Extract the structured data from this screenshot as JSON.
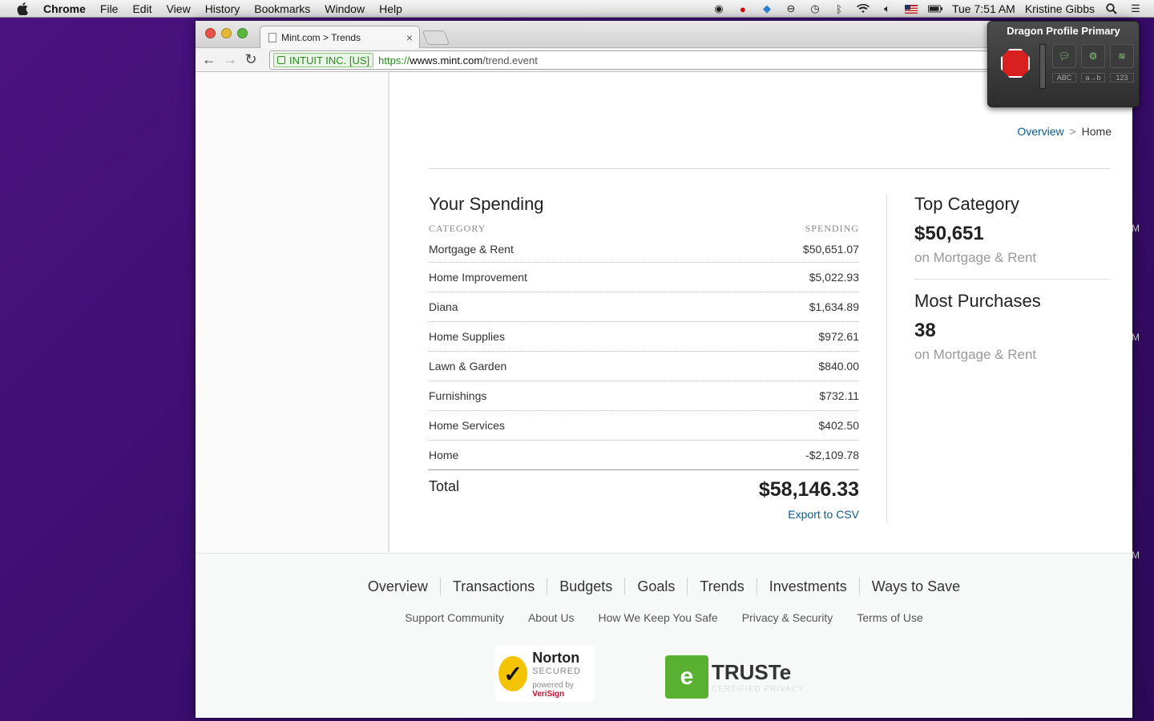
{
  "menubar": {
    "app": "Chrome",
    "items": [
      "File",
      "Edit",
      "View",
      "History",
      "Bookmarks",
      "Window",
      "Help"
    ],
    "clock": "Tue 7:51 AM",
    "user": "Kristine Gibbs"
  },
  "browser": {
    "tab_title": "Mint.com > Trends",
    "ev_label": "INTUIT INC. [US]",
    "url_scheme": "https://",
    "url_host": "wwws.mint.com",
    "url_path": "/trend.event"
  },
  "breadcrumb": {
    "parent": "Overview",
    "sep": ">",
    "current": "Home"
  },
  "spending": {
    "title": "Your Spending",
    "col_category": "CATEGORY",
    "col_spending": "SPENDING",
    "rows": [
      {
        "category": "Mortgage & Rent",
        "amount": "$50,651.07"
      },
      {
        "category": "Home Improvement",
        "amount": "$5,022.93"
      },
      {
        "category": "Diana",
        "amount": "$1,634.89"
      },
      {
        "category": "Home Supplies",
        "amount": "$972.61"
      },
      {
        "category": "Lawn & Garden",
        "amount": "$840.00"
      },
      {
        "category": "Furnishings",
        "amount": "$732.11"
      },
      {
        "category": "Home Services",
        "amount": "$402.50"
      },
      {
        "category": "Home",
        "amount": "-$2,109.78"
      }
    ],
    "total_label": "Total",
    "total_amount": "$58,146.33",
    "export_label": "Export to CSV"
  },
  "side": {
    "top_category": {
      "title": "Top Category",
      "value": "$50,651",
      "sub": "on Mortgage & Rent"
    },
    "most_purchases": {
      "title": "Most Purchases",
      "value": "38",
      "sub": "on Mortgage & Rent"
    }
  },
  "footer": {
    "nav": [
      "Overview",
      "Transactions",
      "Budgets",
      "Goals",
      "Trends",
      "Investments",
      "Ways to Save"
    ],
    "links": [
      "Support Community",
      "About Us",
      "How We Keep You Safe",
      "Privacy & Security",
      "Terms of Use"
    ],
    "norton": {
      "name": "Norton",
      "secured": "SECURED",
      "powered": "powered by",
      "brand": "VeriSign"
    },
    "truste": {
      "name": "TRUSTe",
      "sub": "CERTIFIED PRIVACY"
    }
  },
  "dragon": {
    "title": "Dragon Profile Primary",
    "tool_labels": [
      "ABC",
      "a→b",
      "123"
    ]
  },
  "desktop_fragments": [
    "M",
    "M",
    "M"
  ]
}
